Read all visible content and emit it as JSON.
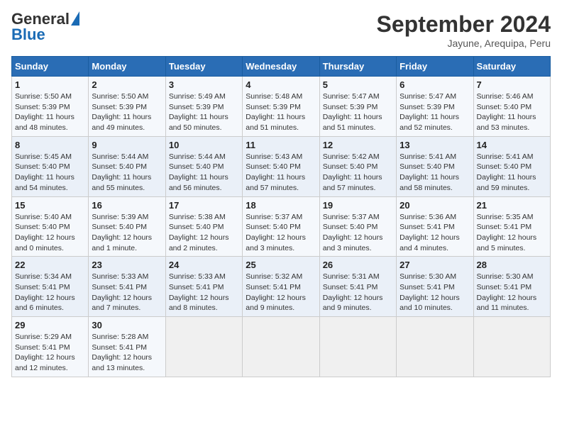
{
  "header": {
    "logo_general": "General",
    "logo_blue": "Blue",
    "month_title": "September 2024",
    "location": "Jayune, Arequipa, Peru"
  },
  "weekdays": [
    "Sunday",
    "Monday",
    "Tuesday",
    "Wednesday",
    "Thursday",
    "Friday",
    "Saturday"
  ],
  "weeks": [
    [
      {
        "day": "1",
        "sunrise": "5:50 AM",
        "sunset": "5:39 PM",
        "daylight": "11 hours and 48 minutes."
      },
      {
        "day": "2",
        "sunrise": "5:50 AM",
        "sunset": "5:39 PM",
        "daylight": "11 hours and 49 minutes."
      },
      {
        "day": "3",
        "sunrise": "5:49 AM",
        "sunset": "5:39 PM",
        "daylight": "11 hours and 50 minutes."
      },
      {
        "day": "4",
        "sunrise": "5:48 AM",
        "sunset": "5:39 PM",
        "daylight": "11 hours and 51 minutes."
      },
      {
        "day": "5",
        "sunrise": "5:47 AM",
        "sunset": "5:39 PM",
        "daylight": "11 hours and 51 minutes."
      },
      {
        "day": "6",
        "sunrise": "5:47 AM",
        "sunset": "5:39 PM",
        "daylight": "11 hours and 52 minutes."
      },
      {
        "day": "7",
        "sunrise": "5:46 AM",
        "sunset": "5:40 PM",
        "daylight": "11 hours and 53 minutes."
      }
    ],
    [
      {
        "day": "8",
        "sunrise": "5:45 AM",
        "sunset": "5:40 PM",
        "daylight": "11 hours and 54 minutes."
      },
      {
        "day": "9",
        "sunrise": "5:44 AM",
        "sunset": "5:40 PM",
        "daylight": "11 hours and 55 minutes."
      },
      {
        "day": "10",
        "sunrise": "5:44 AM",
        "sunset": "5:40 PM",
        "daylight": "11 hours and 56 minutes."
      },
      {
        "day": "11",
        "sunrise": "5:43 AM",
        "sunset": "5:40 PM",
        "daylight": "11 hours and 57 minutes."
      },
      {
        "day": "12",
        "sunrise": "5:42 AM",
        "sunset": "5:40 PM",
        "daylight": "11 hours and 57 minutes."
      },
      {
        "day": "13",
        "sunrise": "5:41 AM",
        "sunset": "5:40 PM",
        "daylight": "11 hours and 58 minutes."
      },
      {
        "day": "14",
        "sunrise": "5:41 AM",
        "sunset": "5:40 PM",
        "daylight": "11 hours and 59 minutes."
      }
    ],
    [
      {
        "day": "15",
        "sunrise": "5:40 AM",
        "sunset": "5:40 PM",
        "daylight": "12 hours and 0 minutes."
      },
      {
        "day": "16",
        "sunrise": "5:39 AM",
        "sunset": "5:40 PM",
        "daylight": "12 hours and 1 minute."
      },
      {
        "day": "17",
        "sunrise": "5:38 AM",
        "sunset": "5:40 PM",
        "daylight": "12 hours and 2 minutes."
      },
      {
        "day": "18",
        "sunrise": "5:37 AM",
        "sunset": "5:40 PM",
        "daylight": "12 hours and 3 minutes."
      },
      {
        "day": "19",
        "sunrise": "5:37 AM",
        "sunset": "5:40 PM",
        "daylight": "12 hours and 3 minutes."
      },
      {
        "day": "20",
        "sunrise": "5:36 AM",
        "sunset": "5:41 PM",
        "daylight": "12 hours and 4 minutes."
      },
      {
        "day": "21",
        "sunrise": "5:35 AM",
        "sunset": "5:41 PM",
        "daylight": "12 hours and 5 minutes."
      }
    ],
    [
      {
        "day": "22",
        "sunrise": "5:34 AM",
        "sunset": "5:41 PM",
        "daylight": "12 hours and 6 minutes."
      },
      {
        "day": "23",
        "sunrise": "5:33 AM",
        "sunset": "5:41 PM",
        "daylight": "12 hours and 7 minutes."
      },
      {
        "day": "24",
        "sunrise": "5:33 AM",
        "sunset": "5:41 PM",
        "daylight": "12 hours and 8 minutes."
      },
      {
        "day": "25",
        "sunrise": "5:32 AM",
        "sunset": "5:41 PM",
        "daylight": "12 hours and 9 minutes."
      },
      {
        "day": "26",
        "sunrise": "5:31 AM",
        "sunset": "5:41 PM",
        "daylight": "12 hours and 9 minutes."
      },
      {
        "day": "27",
        "sunrise": "5:30 AM",
        "sunset": "5:41 PM",
        "daylight": "12 hours and 10 minutes."
      },
      {
        "day": "28",
        "sunrise": "5:30 AM",
        "sunset": "5:41 PM",
        "daylight": "12 hours and 11 minutes."
      }
    ],
    [
      {
        "day": "29",
        "sunrise": "5:29 AM",
        "sunset": "5:41 PM",
        "daylight": "12 hours and 12 minutes."
      },
      {
        "day": "30",
        "sunrise": "5:28 AM",
        "sunset": "5:41 PM",
        "daylight": "12 hours and 13 minutes."
      },
      null,
      null,
      null,
      null,
      null
    ]
  ]
}
